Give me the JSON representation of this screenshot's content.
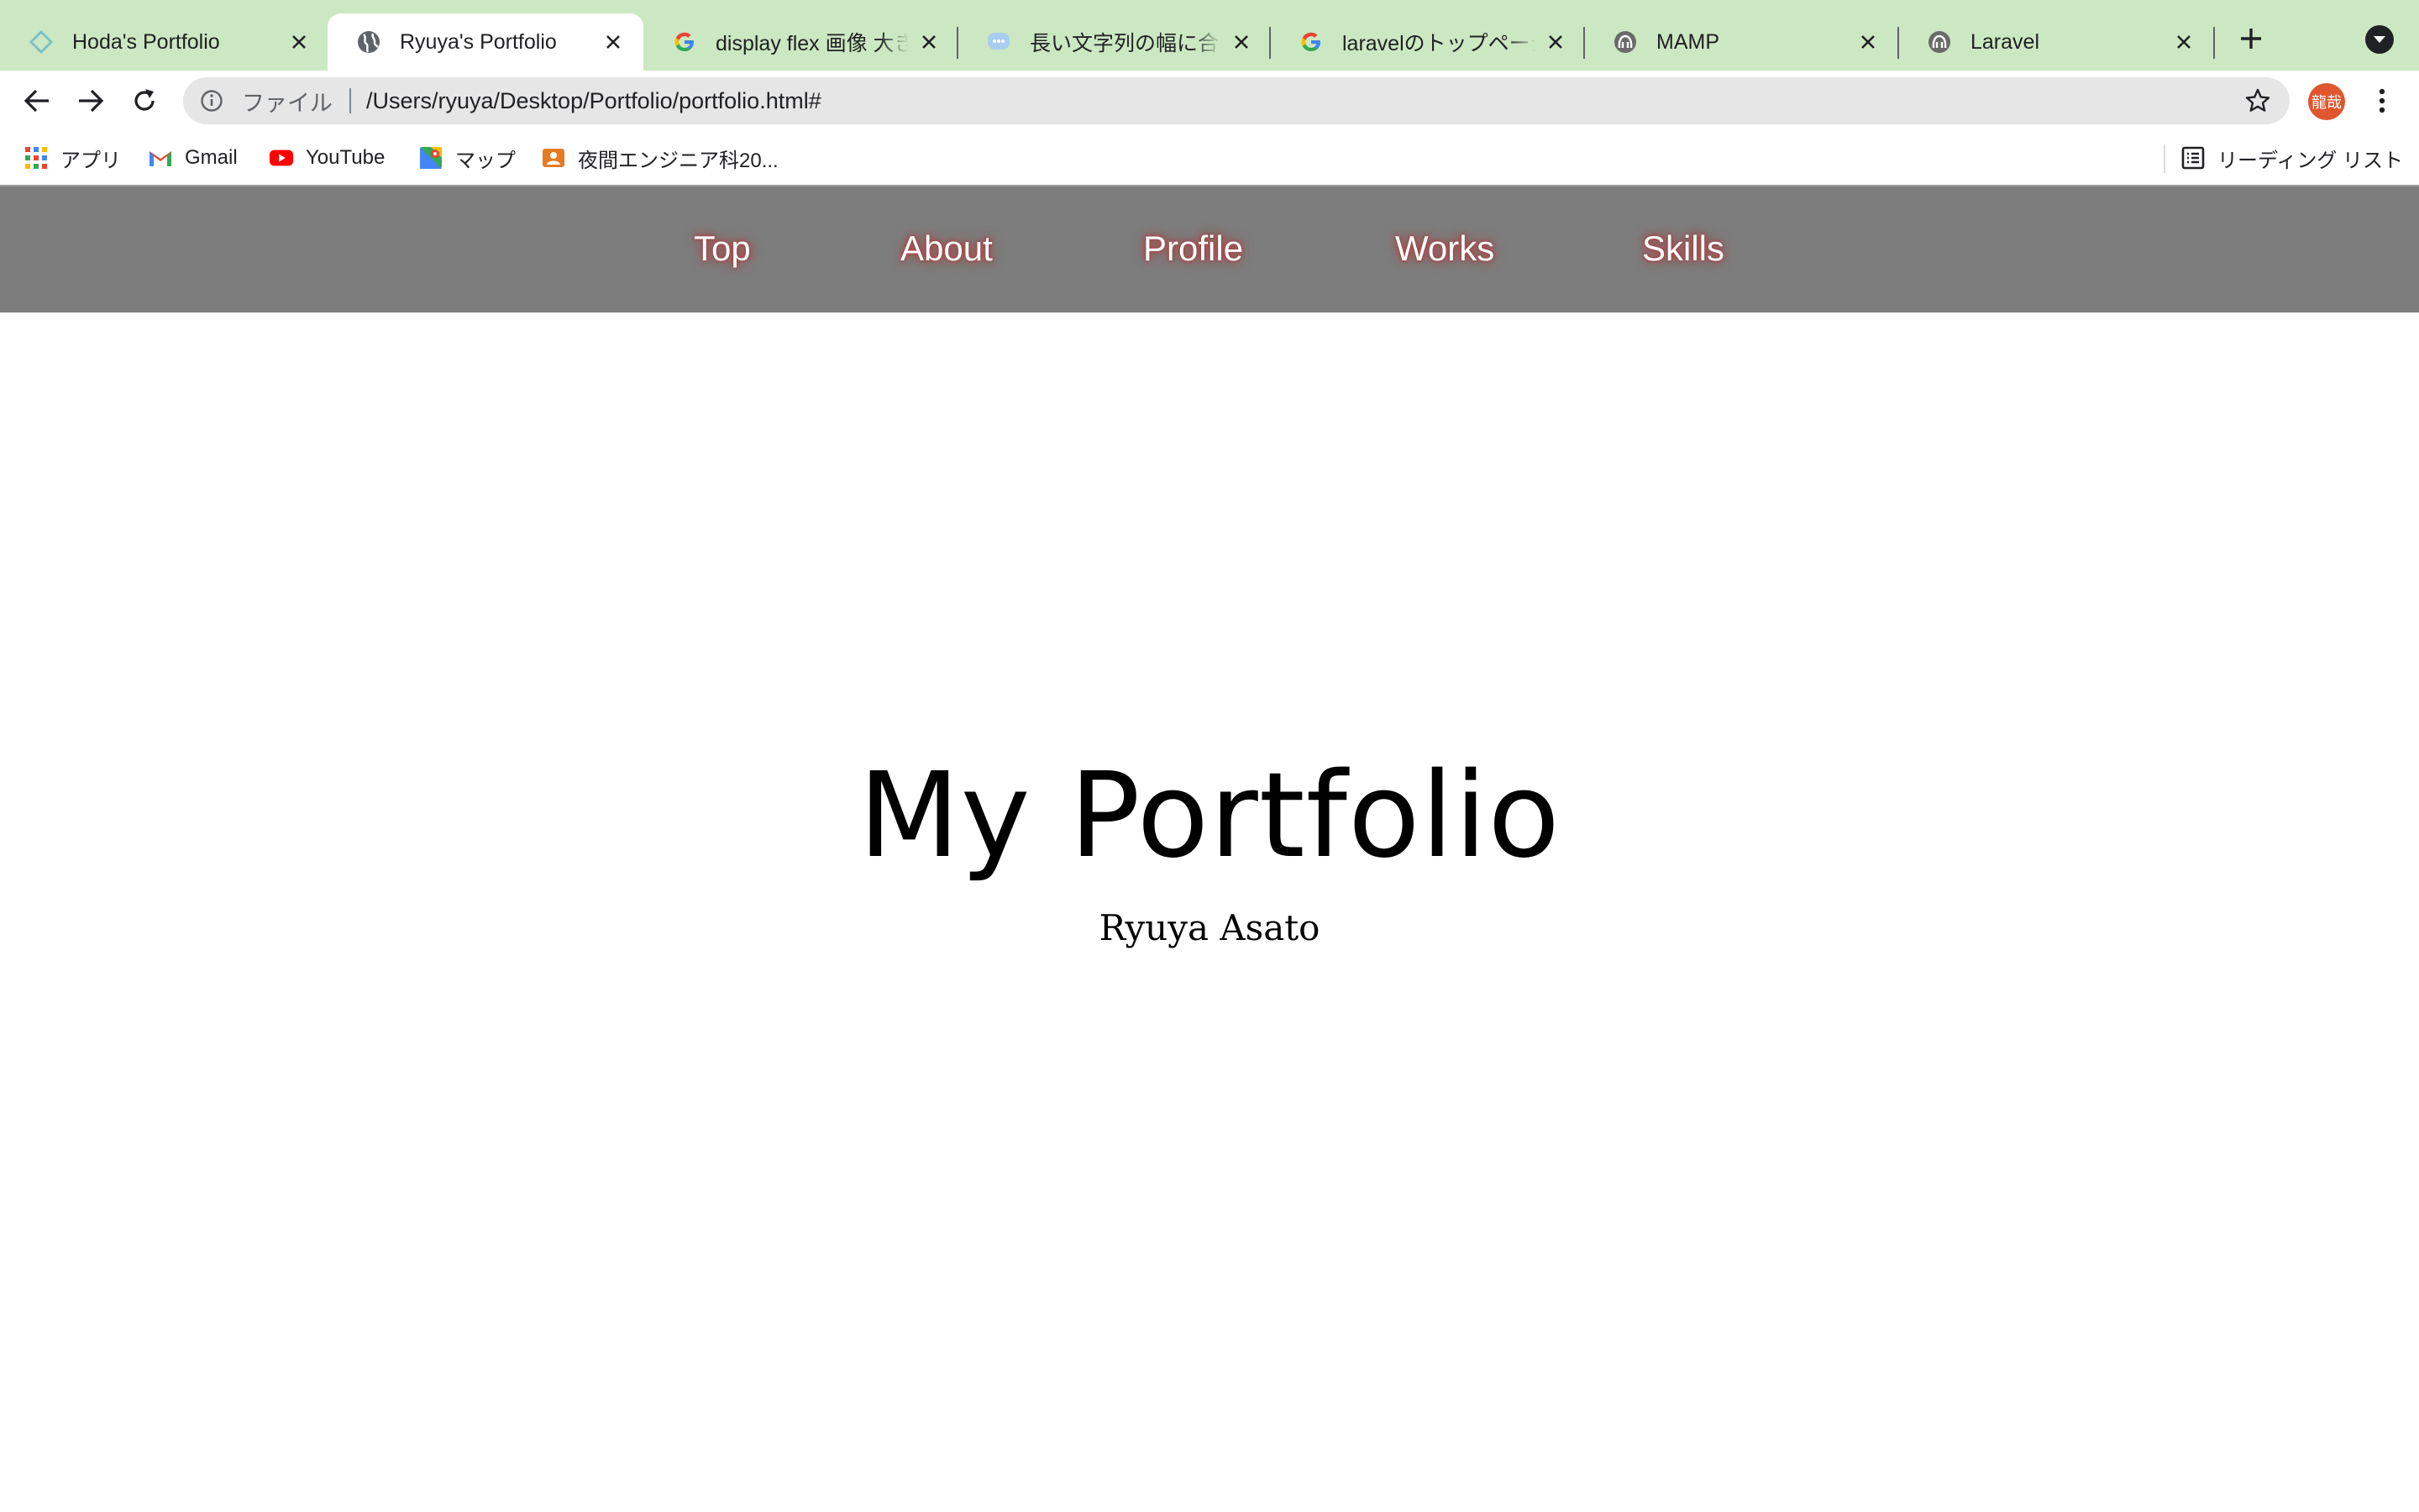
{
  "browser": {
    "tabs": [
      {
        "title": "Hoda's Portfolio",
        "icon": "diamond-icon",
        "active": false
      },
      {
        "title": "Ryuya's Portfolio",
        "icon": "globe-icon",
        "active": true
      },
      {
        "title": "display flex 画像 大きさ",
        "icon": "google-icon",
        "active": false
      },
      {
        "title": "長い文字列の幅に合わせ",
        "icon": "chat-icon",
        "active": false
      },
      {
        "title": "laravelのトップページ",
        "icon": "google-icon",
        "active": false
      },
      {
        "title": "MAMP",
        "icon": "elephant-icon",
        "active": false
      },
      {
        "title": "Laravel",
        "icon": "elephant-icon",
        "active": false
      }
    ],
    "omnibox": {
      "scheme_label": "ファイル",
      "url": "/Users/ryuya/Desktop/Portfolio/portfolio.html#"
    },
    "profile_initials": "龍哉",
    "bookmarks": [
      {
        "label": "アプリ",
        "icon": "apps-grid-icon"
      },
      {
        "label": "Gmail",
        "icon": "gmail-icon"
      },
      {
        "label": "YouTube",
        "icon": "youtube-icon"
      },
      {
        "label": "マップ",
        "icon": "maps-icon"
      },
      {
        "label": "夜間エンジニア科20...",
        "icon": "contact-icon"
      }
    ],
    "reading_list_label": "リーディング リスト"
  },
  "page": {
    "nav": [
      "Top",
      "About",
      "Profile",
      "Works",
      "Skills"
    ],
    "title": "My Portfolio",
    "subtitle": "Ryuya Asato"
  },
  "colors": {
    "tabstrip": "#cce8c2",
    "site_nav": "#7d7d7d",
    "nav_glow": "#b54b4b",
    "avatar": "#e0562f"
  }
}
